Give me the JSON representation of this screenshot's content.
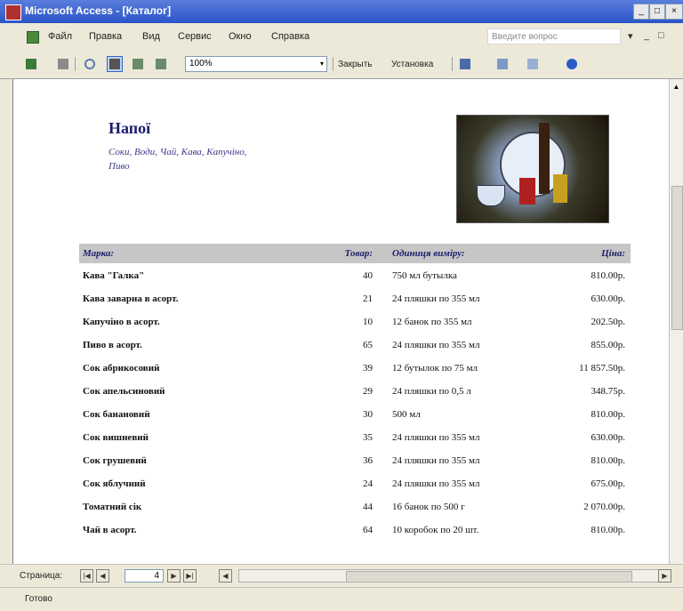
{
  "window": {
    "title": "Microsoft Access - [Каталог]",
    "buttons": {
      "minimize": "_",
      "restore": "□",
      "close": "×"
    }
  },
  "menu": {
    "items": [
      "Файл",
      "Правка",
      "Вид",
      "Сервис",
      "Окно",
      "Справка"
    ],
    "help_placeholder": "Введите вопрос",
    "help_arrow": "▾",
    "doc_minimize": "_",
    "doc_restore": "□"
  },
  "toolbar": {
    "zoom": "100%",
    "zoom_arrow": "▾",
    "close_label": "Закрыть",
    "setup_label": "Установка"
  },
  "report": {
    "title": "Напої",
    "description": "Соки, Води, Чай, Кава, Капучіно, Пиво",
    "columns": {
      "brand": "Марка:",
      "product": "Товар:",
      "unit": "Одиниця виміру:",
      "price": "Ціна:"
    },
    "rows": [
      {
        "name": "Кава \"Галка\"",
        "qty": "40",
        "unit": "750 мл бутылка",
        "price": "810.00р."
      },
      {
        "name": "Кава заварна в асорт.",
        "qty": "21",
        "unit": "24 пляшки по 355 мл",
        "price": "630.00р."
      },
      {
        "name": "Капучіно в асорт.",
        "qty": "10",
        "unit": "12 банок по 355 мл",
        "price": "202.50р."
      },
      {
        "name": "Пиво в асорт.",
        "qty": "65",
        "unit": "24 пляшки по 355 мл",
        "price": "855.00р."
      },
      {
        "name": "Сок абрикосовий",
        "qty": "39",
        "unit": "12 бутылок по 75 мл",
        "price": "11 857.50р."
      },
      {
        "name": "Сок апельсиновий",
        "qty": "29",
        "unit": "24 пляшки по 0,5 л",
        "price": "348.75р."
      },
      {
        "name": "Сок банановий",
        "qty": "30",
        "unit": "500 мл",
        "price": "810.00р."
      },
      {
        "name": "Сок вишневий",
        "qty": "35",
        "unit": "24 пляшки по 355 мл",
        "price": "630.00р."
      },
      {
        "name": "Сок грушевий",
        "qty": "36",
        "unit": "24 пляшки по 355 мл",
        "price": "810.00р."
      },
      {
        "name": "Сок яблучний",
        "qty": "24",
        "unit": "24 пляшки по 355 мл",
        "price": "675.00р."
      },
      {
        "name": "Томатний сік",
        "qty": "44",
        "unit": "16 банок по 500 г",
        "price": "2 070.00р."
      },
      {
        "name": "Чай в асорт.",
        "qty": "64",
        "unit": "10 коробок по 20 шт.",
        "price": "810.00р."
      }
    ]
  },
  "navigation": {
    "label": "Страница:",
    "page": "4",
    "first": "|◀",
    "prev": "◀",
    "next": "▶",
    "last": "▶|",
    "scroll_left": "◀",
    "scroll_right": "▶",
    "scroll_up": "▲"
  },
  "status": "Готово"
}
